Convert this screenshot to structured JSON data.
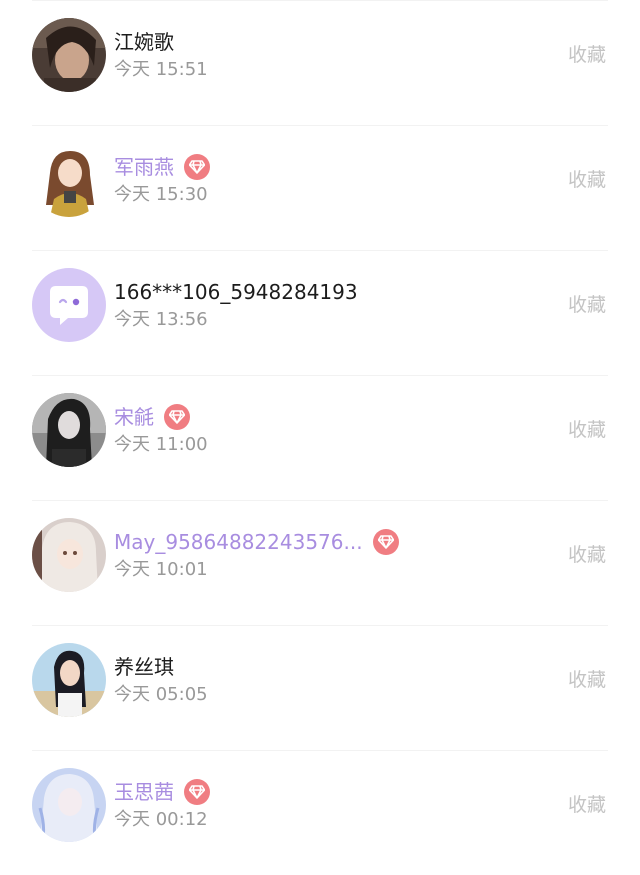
{
  "favorite_label": "收藏",
  "accent_color": "#a88de0",
  "badge_color": "#f07d82",
  "contacts": [
    {
      "name": "江婉歌",
      "time": "今天 15:51",
      "vip": false,
      "avatar": "girl-portrait-dark"
    },
    {
      "name": "军雨燕",
      "time": "今天 15:30",
      "vip": true,
      "avatar": "cartoon-girl"
    },
    {
      "name": "166***106_5948284193",
      "time": "今天 13:56",
      "vip": false,
      "avatar": "default-chat-bubble"
    },
    {
      "name": "宋毹",
      "time": "今天 11:00",
      "vip": true,
      "avatar": "girl-portrait-bw"
    },
    {
      "name": "May_95864882243576...",
      "time": "今天 10:01",
      "vip": true,
      "avatar": "anime-girl"
    },
    {
      "name": "养丝琪",
      "time": "今天 05:05",
      "vip": false,
      "avatar": "girl-portrait-outdoor"
    },
    {
      "name": "玉思茜",
      "time": "今天 00:12",
      "vip": true,
      "avatar": "anime-girl-blue"
    }
  ]
}
